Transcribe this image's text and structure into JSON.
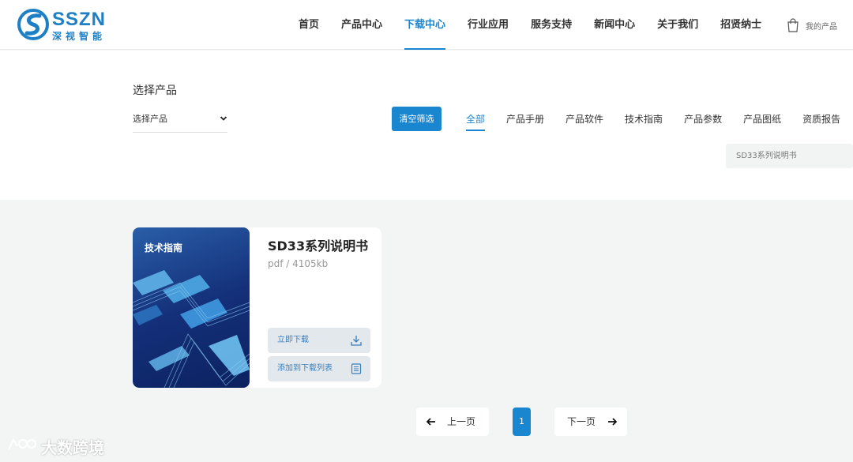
{
  "brand": {
    "name_en": "SSZN",
    "name_cn": "深视智能",
    "color": "#1e7fc4"
  },
  "nav": {
    "items": [
      {
        "label": "首页"
      },
      {
        "label": "产品中心"
      },
      {
        "label": "下载中心",
        "active": true
      },
      {
        "label": "行业应用"
      },
      {
        "label": "服务支持"
      },
      {
        "label": "新闻中心"
      },
      {
        "label": "关于我们"
      },
      {
        "label": "招贤纳士"
      }
    ],
    "my_products": {
      "label": "我的产品",
      "icon": "shopping-bag-icon"
    }
  },
  "filter": {
    "title": "选择产品",
    "product_select": {
      "value": "选择产品",
      "icon": "chevron-down-icon"
    },
    "clear_button": "清空筛选",
    "tabs": [
      {
        "label": "全部",
        "active": true
      },
      {
        "label": "产品手册"
      },
      {
        "label": "产品软件"
      },
      {
        "label": "技术指南"
      },
      {
        "label": "产品参数"
      },
      {
        "label": "产品图纸"
      },
      {
        "label": "资质报告"
      }
    ],
    "search": {
      "value": "SD33系列说明书"
    }
  },
  "results": [
    {
      "cover_label": "技术指南",
      "title": "SD33系列说明书",
      "meta": "pdf / 4105kb",
      "download_label": "立即下载",
      "add_label": "添加到下载列表",
      "download_icon": "download-icon",
      "add_icon": "list-icon"
    }
  ],
  "pagination": {
    "prev_label": "上一页",
    "next_label": "下一页",
    "current_page": "1"
  },
  "watermark": {
    "text": "大数跨境"
  },
  "colors": {
    "accent": "#1a86d0",
    "background": "#f3f4f4"
  }
}
